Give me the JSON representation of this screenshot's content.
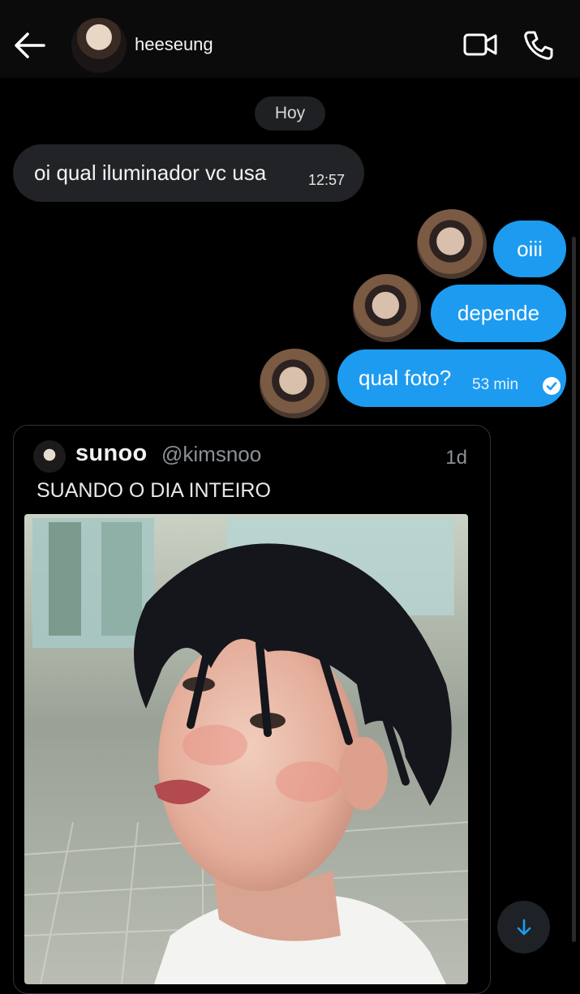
{
  "header": {
    "contact_name": "heeseung"
  },
  "chat": {
    "date_label": "Hoy",
    "incoming": {
      "text": "oi qual iluminador vc usa",
      "time": "12:57"
    },
    "outgoing": [
      {
        "text": "oiii"
      },
      {
        "text": "depende"
      },
      {
        "text": "qual foto?",
        "time": "53 min"
      }
    ]
  },
  "tweet": {
    "name": "sunoo",
    "handle": "@kimsnoo",
    "age": "1d",
    "text": "SUANDO O DIA INTEIRO"
  },
  "colors": {
    "accent": "#1d9bf0",
    "incoming_bubble": "#222326",
    "background": "#000000"
  },
  "icons": [
    "arrow-left-icon",
    "video-call-icon",
    "phone-icon",
    "read-check-icon",
    "arrow-down-icon"
  ]
}
